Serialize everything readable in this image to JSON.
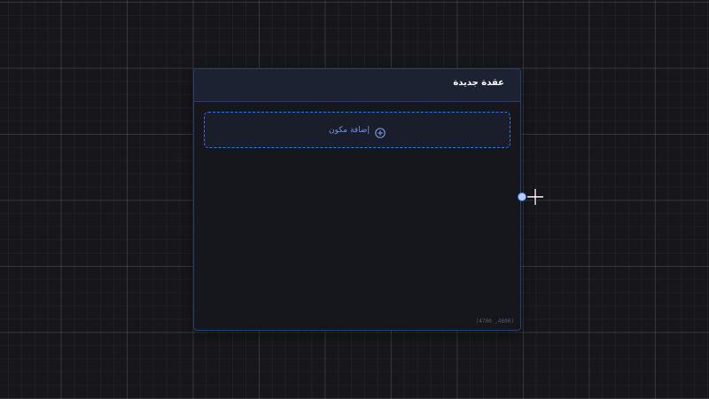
{
  "node": {
    "title": "عقدة جديدة",
    "add_component_label": "إضافة مكون",
    "coordinates": "(4700 ,4800)"
  },
  "icons": {
    "add": "plus-circle-icon",
    "cursor": "crosshair-cursor-icon"
  },
  "colors": {
    "canvas_bg": "#17171b",
    "node_border": "#27406d",
    "node_header_bg": "#1d2233",
    "accent": "#3a76e0",
    "accent_text": "#6f93d8"
  }
}
